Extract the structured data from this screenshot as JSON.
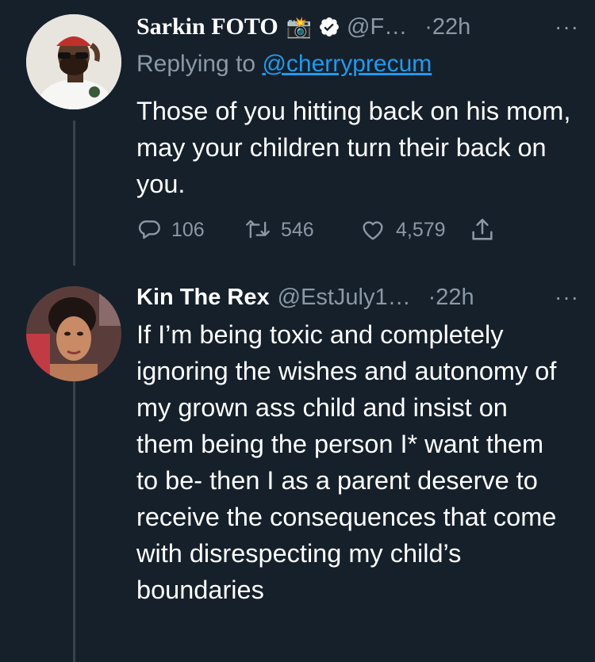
{
  "tweets": [
    {
      "name": "Sarkin FOTO",
      "name_emoji": "📸",
      "handle": "@F…",
      "time": "·22h",
      "more": "···",
      "replying_prefix": "Replying to ",
      "replying_handle": "@cherryprecum",
      "text": "Those of you hitting back on his mom, may your children turn their back on you.",
      "replies": "106",
      "retweets": "546",
      "likes": "4,579",
      "verified": true,
      "avatar_icon": "man-with-red-cap-avatar"
    },
    {
      "name": "Kin The Rex",
      "handle": "@EstJuly1…",
      "time": "·22h",
      "more": "···",
      "text": "If I’m being toxic and completely ignoring the wishes and autonomy of my grown ass child and insist on them being the person I* want them to be- then I as a parent deserve to receive the consequences that come with disrespecting my child’s boundaries",
      "avatar_icon": "woman-avatar"
    }
  ],
  "colors": {
    "background": "#15202b",
    "secondary_text": "#8b98a5",
    "link": "#1d9bf0",
    "thread_line": "#38444d"
  }
}
